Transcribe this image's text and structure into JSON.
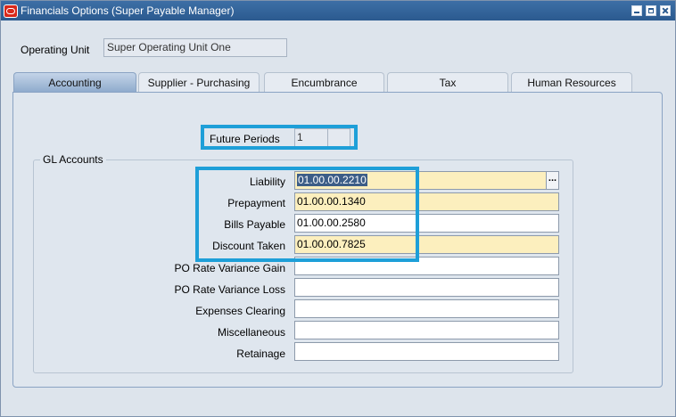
{
  "window": {
    "title": "Financials Options (Super Payable Manager)"
  },
  "operating_unit": {
    "label": "Operating Unit",
    "value": "Super Operating Unit One"
  },
  "tabs": [
    {
      "label": "Accounting",
      "active": true
    },
    {
      "label": "Supplier - Purchasing",
      "active": false
    },
    {
      "label": "Encumbrance",
      "active": false
    },
    {
      "label": "Tax",
      "active": false
    },
    {
      "label": "Human Resources",
      "active": false
    }
  ],
  "future_periods": {
    "label": "Future Periods",
    "value": "1"
  },
  "gl_accounts": {
    "title": "GL Accounts",
    "fields": [
      {
        "label": "Liability",
        "value": "01.00.00.2210"
      },
      {
        "label": "Prepayment",
        "value": "01.00.00.1340"
      },
      {
        "label": "Bills Payable",
        "value": "01.00.00.2580"
      },
      {
        "label": "Discount Taken",
        "value": "01.00.00.7825"
      },
      {
        "label": "PO Rate Variance Gain",
        "value": ""
      },
      {
        "label": "PO Rate Variance Loss",
        "value": ""
      },
      {
        "label": "Expenses Clearing",
        "value": ""
      },
      {
        "label": "Miscellaneous",
        "value": ""
      },
      {
        "label": "Retainage",
        "value": ""
      }
    ],
    "lov_button_label": "..."
  },
  "colors": {
    "highlight": "#1e9fd8",
    "required_field": "#fcefbe",
    "titlebar": "#2b5a8f"
  }
}
